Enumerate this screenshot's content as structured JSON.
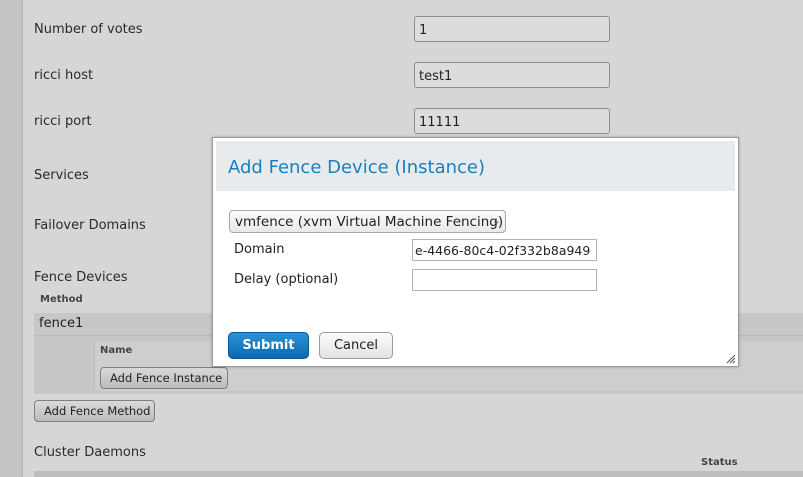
{
  "form": {
    "votes_label": "Number of votes",
    "votes_value": "1",
    "ricci_host_label": "ricci host",
    "ricci_host_value": "test1",
    "ricci_port_label": "ricci port",
    "ricci_port_value": "11111",
    "services_label": "Services",
    "failover_label": "Failover Domains",
    "fence_devices_label": "Fence Devices",
    "method_header": "Method",
    "method_name": "fence1",
    "name_header": "Name",
    "add_fence_instance_label": "Add Fence Instance",
    "add_fence_method_label": "Add Fence Method",
    "cluster_daemons_label": "Cluster Daemons",
    "status_header": "Status"
  },
  "dialog": {
    "title": "Add Fence Device (Instance)",
    "agent_selected": "vmfence (xvm Virtual Machine Fencing)",
    "domain_label": "Domain",
    "domain_value": "e-4466-80c4-02f332b8a949",
    "delay_label": "Delay (optional)",
    "delay_value": "",
    "submit_label": "Submit",
    "cancel_label": "Cancel"
  },
  "colors": {
    "accent": "#1a7fbf",
    "submit_bg": "#1877bd"
  }
}
